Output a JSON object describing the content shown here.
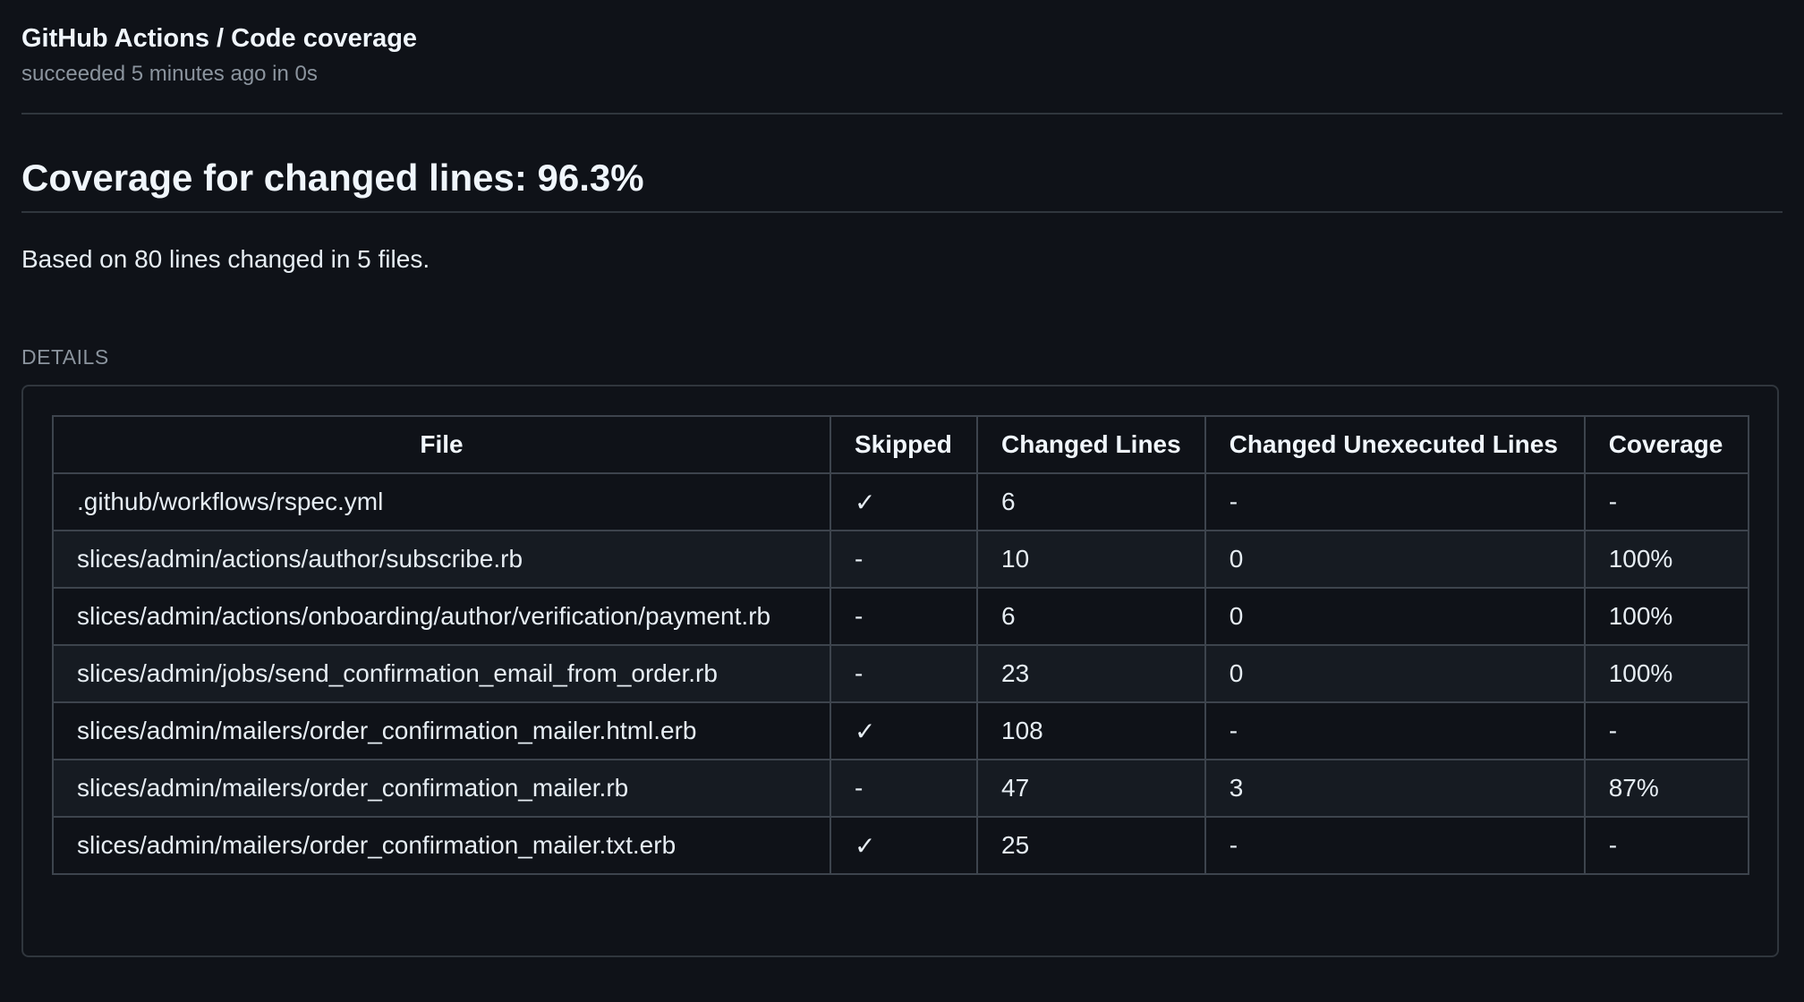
{
  "check": {
    "title": "GitHub Actions / Code coverage",
    "subtitle": "succeeded 5 minutes ago in 0s"
  },
  "summary": {
    "heading": "Coverage for changed lines: 96.3%",
    "text": "Based on 80 lines changed in 5 files."
  },
  "details": {
    "label": "DETAILS",
    "table": {
      "headers": [
        "File",
        "Skipped",
        "Changed Lines",
        "Changed Unexecuted Lines",
        "Coverage"
      ],
      "rows": [
        [
          ".github/workflows/rspec.yml",
          "✓",
          "6",
          "-",
          "-"
        ],
        [
          "slices/admin/actions/author/subscribe.rb",
          "-",
          "10",
          "0",
          "100%"
        ],
        [
          "slices/admin/actions/onboarding/author/verification/payment.rb",
          "-",
          "6",
          "0",
          "100%"
        ],
        [
          "slices/admin/jobs/send_confirmation_email_from_order.rb",
          "-",
          "23",
          "0",
          "100%"
        ],
        [
          "slices/admin/mailers/order_confirmation_mailer.html.erb",
          "✓",
          "108",
          "-",
          "-"
        ],
        [
          "slices/admin/mailers/order_confirmation_mailer.rb",
          "-",
          "47",
          "3",
          "87%"
        ],
        [
          "slices/admin/mailers/order_confirmation_mailer.txt.erb",
          "✓",
          "25",
          "-",
          "-"
        ]
      ]
    }
  }
}
